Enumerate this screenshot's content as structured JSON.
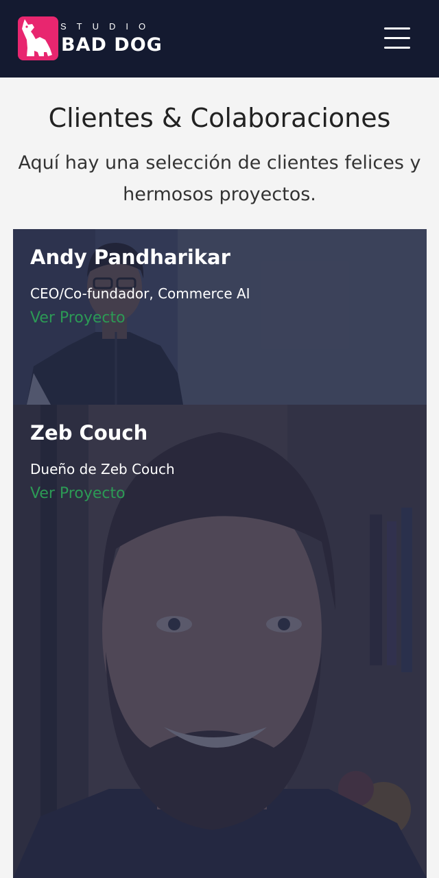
{
  "header": {
    "logo_top": "STUDIO",
    "logo_name": "BAD DOG",
    "menu_icon": "hamburger-menu-icon"
  },
  "intro": {
    "title": "Clientes & Colaboraciones",
    "text": "Aquí hay una selección de clientes felices y hermosos proyectos."
  },
  "clients": [
    {
      "name": "Andy Pandharikar",
      "role": "CEO/Co-fundador, Commerce AI",
      "link": "Ver Proyecto"
    },
    {
      "name": "Zeb Couch",
      "role": "Dueño de Zeb Couch",
      "link": "Ver Proyecto"
    }
  ],
  "colors": {
    "header_bg": "#141a30",
    "brand_pink": "#e8266f",
    "link_green": "#2c9a55",
    "page_bg": "#f4f4f4"
  }
}
